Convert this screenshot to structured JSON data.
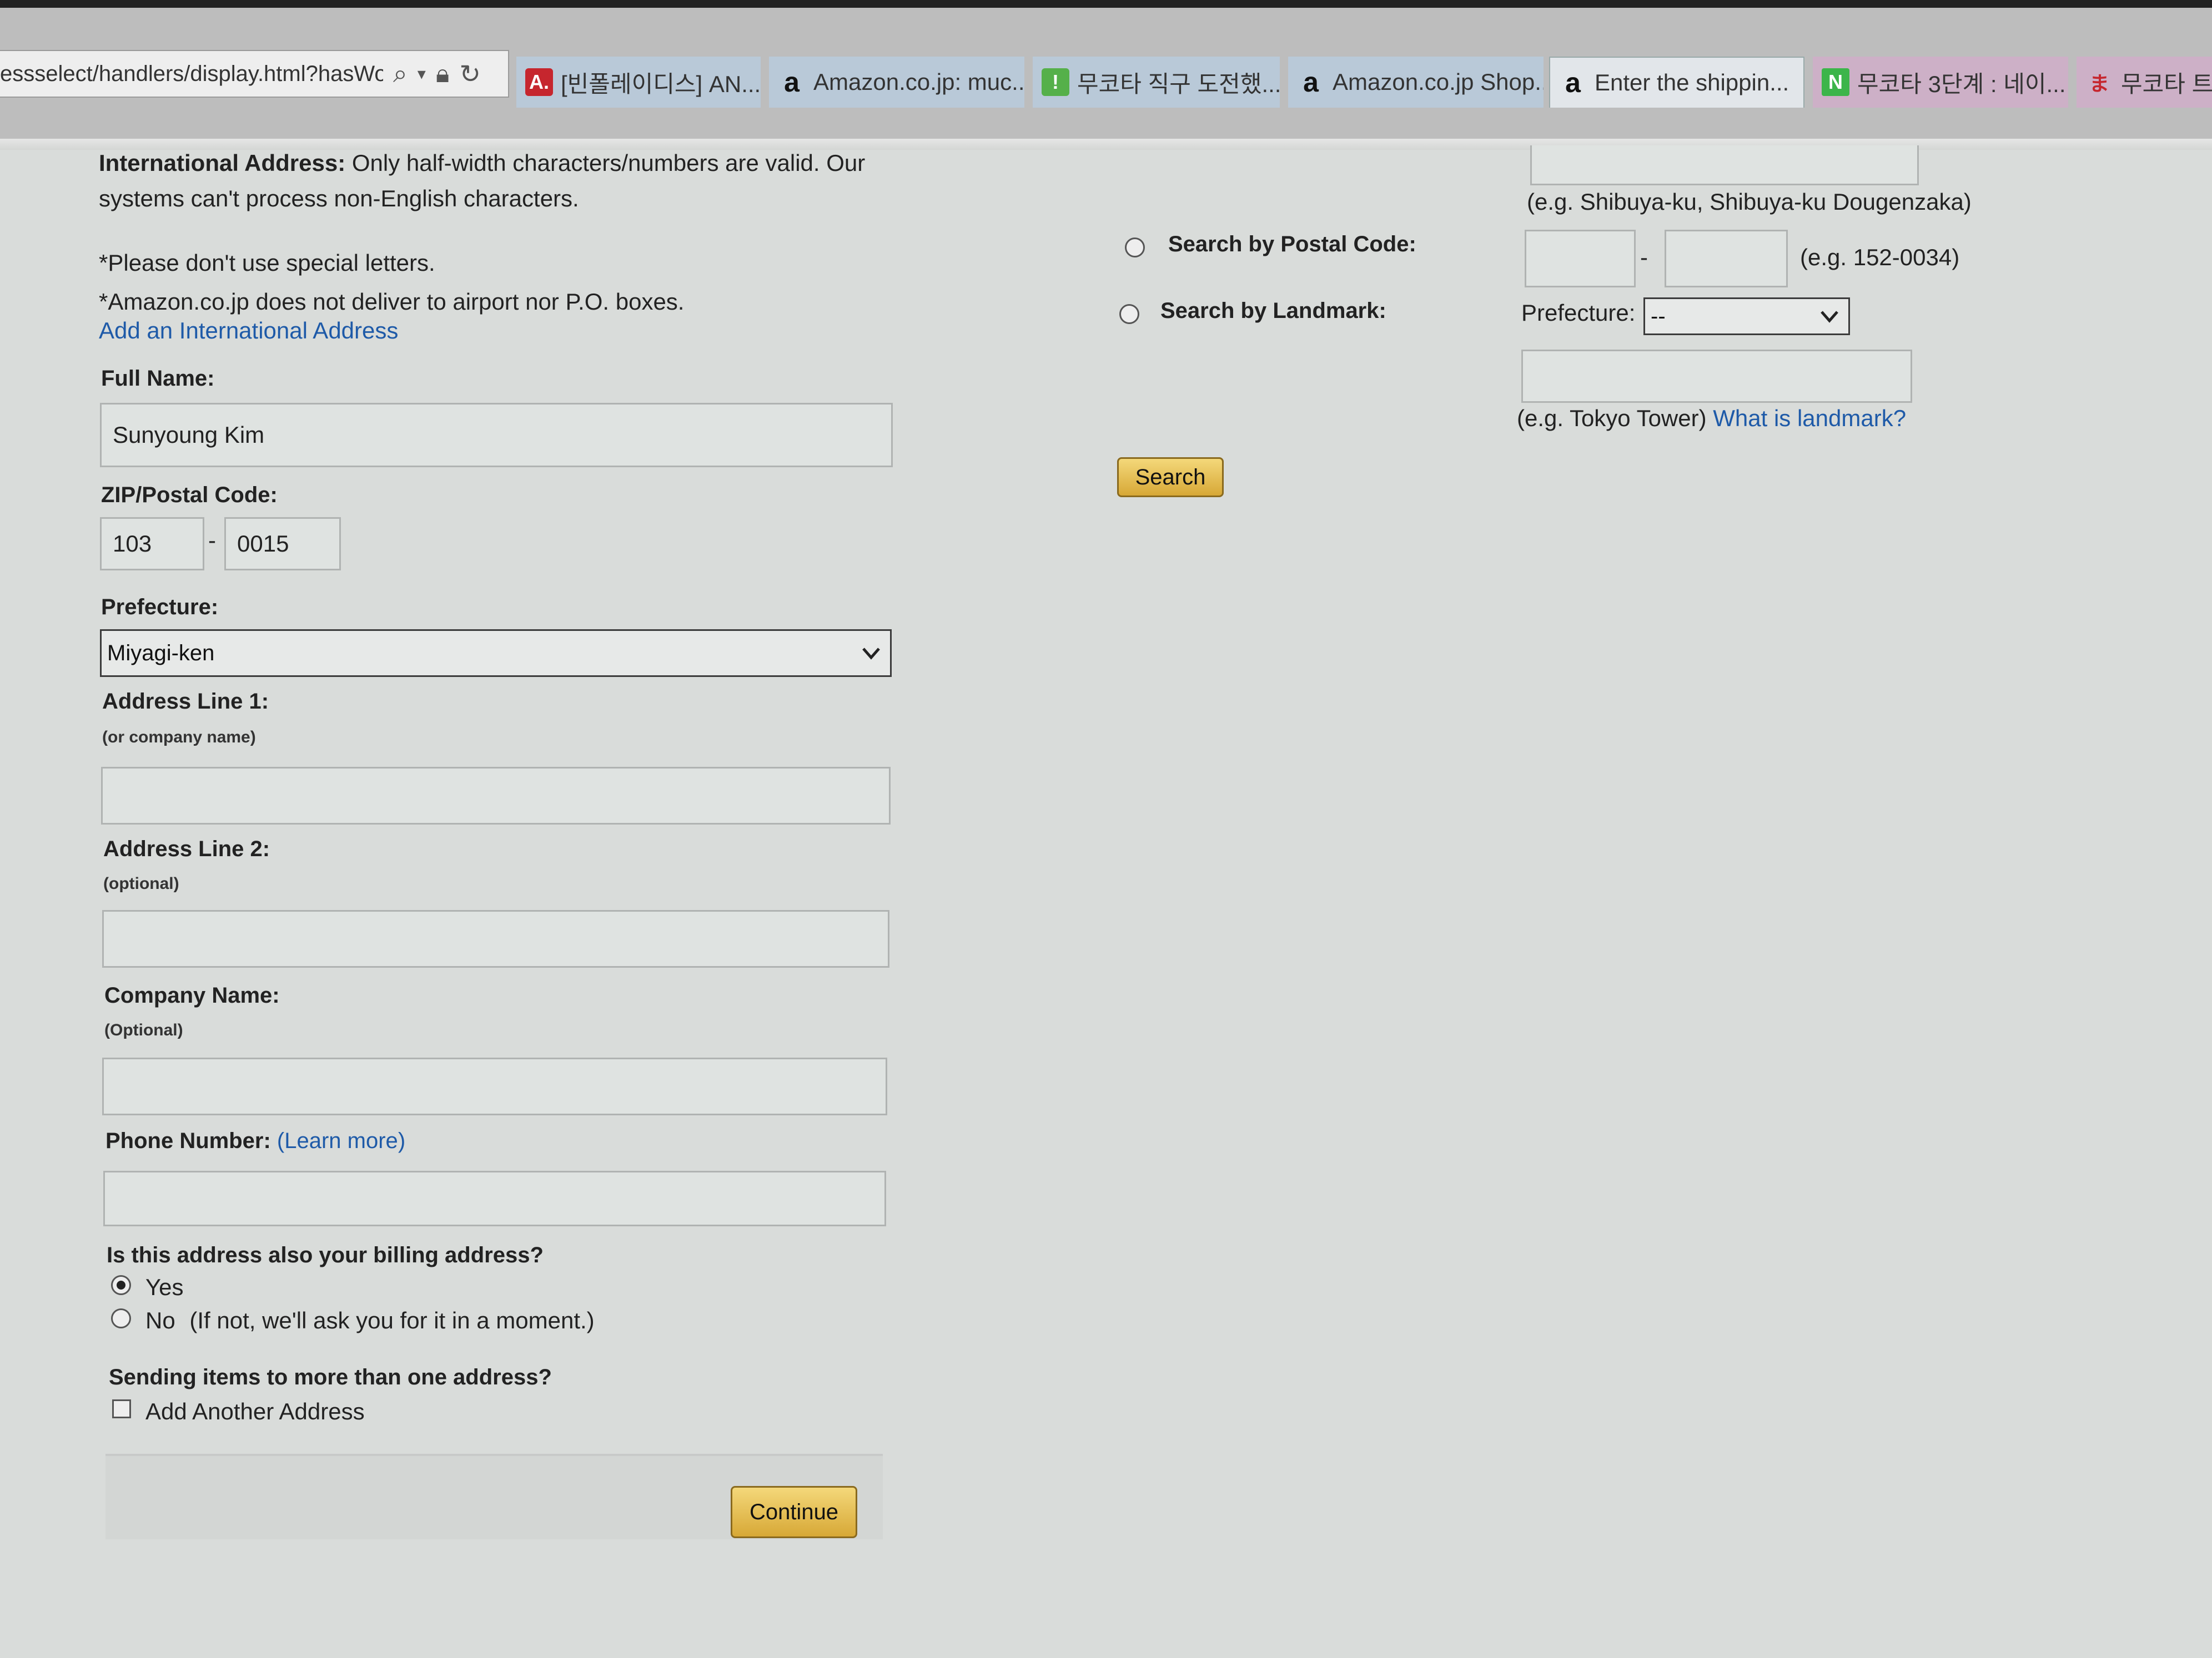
{
  "browser": {
    "address_text": "essselect/handlers/display.html?hasWorkinc",
    "tabs": [
      {
        "label": "[빈폴레이디스] AN...",
        "favicon_text": "A."
      },
      {
        "label": "Amazon.co.jp: muc...",
        "favicon_text": "a"
      },
      {
        "label": "무코타 직구 도전했...",
        "favicon_text": "!"
      },
      {
        "label": "Amazon.co.jp Shop...",
        "favicon_text": "a"
      },
      {
        "label": "Enter the shippin...",
        "favicon_text": "a",
        "active": true
      },
      {
        "label": "무코타 3단계 : 네이...",
        "favicon_text": "N"
      },
      {
        "label": "무코타 트",
        "favicon_text": "ま"
      }
    ],
    "close_glyph": "✕"
  },
  "left": {
    "intl_note_bold": "International Address:",
    "intl_note_rest": "Only half-width characters/numbers are valid. Our",
    "intl_note_line2": "systems can't process non-English characters.",
    "note_special": "*Please don't use special letters.",
    "note_airport": "*Amazon.co.jp does not deliver to airport nor P.O. boxes.",
    "add_intl_link": "Add an International Address",
    "full_name_label": "Full Name:",
    "full_name_value": "Sunyoung Kim",
    "zip_label": "ZIP/Postal Code:",
    "zip_part1": "103",
    "zip_dash": "-",
    "zip_part2": "0015",
    "prefecture_label": "Prefecture:",
    "prefecture_value": "Miyagi-ken",
    "address1_label": "Address Line 1:",
    "address1_sub": "(or company name)",
    "address2_label": "Address Line 2:",
    "address2_sub": "(optional)",
    "company_label": "Company Name:",
    "company_sub": "(Optional)",
    "phone_label": "Phone Number:",
    "phone_learn_open": "(",
    "phone_learn_link": "Learn more",
    "phone_learn_close": ")",
    "billing_question": "Is this address also your billing address?",
    "billing_yes": "Yes",
    "billing_no": "No",
    "billing_no_note": "(If not, we'll ask you for it in a moment.)",
    "multi_question": "Sending items to more than one address?",
    "add_another": "Add Another Address",
    "continue_label": "Continue"
  },
  "right": {
    "example_area": "(e.g. Shibuya-ku, Shibuya-ku Dougenzaka)",
    "search_postal_label": "Search by Postal Code:",
    "postal_dash": "-",
    "postal_example": "(e.g. 152-0034)",
    "search_landmark_label": "Search by Landmark:",
    "prefecture_label": "Prefecture:",
    "prefecture_value": "--",
    "landmark_example": "(e.g. Tokyo Tower)",
    "landmark_link": "What is landmark?",
    "search_button": "Search"
  }
}
